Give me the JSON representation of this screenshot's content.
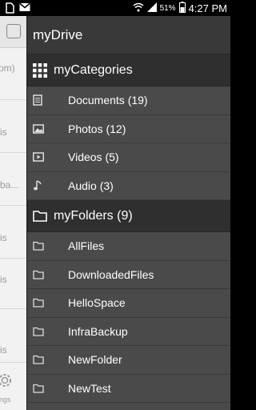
{
  "status_bar": {
    "battery": "51%",
    "time": "4:27 PM"
  },
  "background_app": {
    "rows": [
      "om)",
      "is",
      "ba...",
      "is",
      "is",
      "is"
    ],
    "settings_label": "ttings"
  },
  "drawer": {
    "title": "myDrive",
    "categories_header": "myCategories",
    "categories": [
      {
        "label": "Documents (19)",
        "icon": "document-icon"
      },
      {
        "label": "Photos (12)",
        "icon": "photo-icon"
      },
      {
        "label": "Videos (5)",
        "icon": "video-icon"
      },
      {
        "label": "Audio (3)",
        "icon": "music-note-icon"
      }
    ],
    "folders_header": "myFolders (9)",
    "folders": [
      {
        "label": "AllFiles"
      },
      {
        "label": "DownloadedFiles"
      },
      {
        "label": "HelloSpace"
      },
      {
        "label": "InfraBackup"
      },
      {
        "label": "NewFolder"
      },
      {
        "label": "NewTest"
      }
    ]
  }
}
